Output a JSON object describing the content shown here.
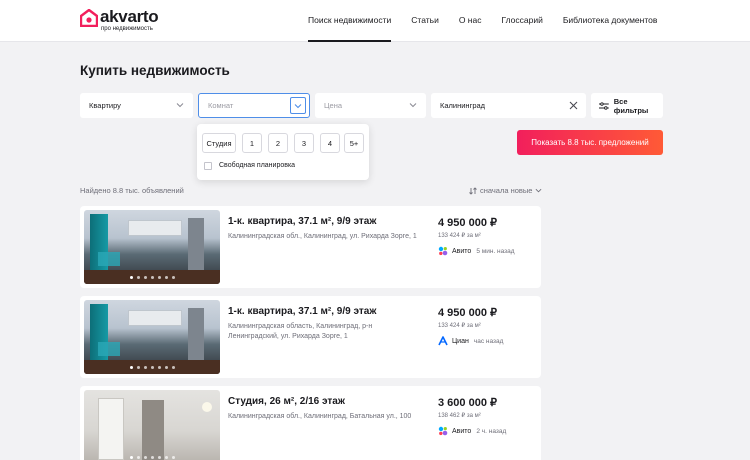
{
  "header": {
    "logo_name": "akvarto",
    "logo_tagline": "про недвижимость",
    "nav": [
      {
        "label": "Поиск недвижимости",
        "active": true
      },
      {
        "label": "Статьи",
        "active": false
      },
      {
        "label": "О нас",
        "active": false
      },
      {
        "label": "Глоссарий",
        "active": false
      },
      {
        "label": "Библиотека документов",
        "active": false
      }
    ]
  },
  "page_title": "Купить недвижимость",
  "filters": {
    "type": {
      "value": "Квартиру",
      "icon": "chevron-down-icon"
    },
    "rooms": {
      "placeholder": "Комнат",
      "icon": "chevron-down-icon"
    },
    "price": {
      "placeholder": "Цена",
      "icon": "chevron-down-icon"
    },
    "city": {
      "value": "Калининград",
      "icon": "close-icon"
    },
    "all_filters": {
      "label": "Все фильтры",
      "icon": "sliders-icon"
    }
  },
  "rooms_dropdown": {
    "options": [
      "Студия",
      "1",
      "2",
      "3",
      "4",
      "5+"
    ],
    "free_layout_label": "Свободная планировка",
    "free_layout_checked": false
  },
  "show_button": "Показать 8.8 тыс. предложений",
  "results": {
    "found_text": "Найдено 8.8 тыс. объявлений",
    "sort_label": "сначала новые"
  },
  "listings": [
    {
      "title": "1-к. квартира, 37.1 м², 9/9 этаж",
      "address": "Калининградская обл., Калининград, ул. Рихарда Зорге, 1",
      "price": "4 950 000 ₽",
      "price_per_m2": "133 424 ₽ за м²",
      "source": "Авито",
      "source_icon": "avito-icon",
      "time": "5 мин. назад"
    },
    {
      "title": "1-к. квартира, 37.1 м², 9/9 этаж",
      "address": "Калининградская область, Калининград, р-н Ленинградский, ул. Рихарда Зорге, 1",
      "price": "4 950 000 ₽",
      "price_per_m2": "133 424 ₽ за м²",
      "source": "Циан",
      "source_icon": "cian-icon",
      "time": "час назад"
    },
    {
      "title": "Студия, 26 м², 2/16 этаж",
      "address": "Калининградская обл., Калининград, Батальная ул., 100",
      "price": "3 600 000 ₽",
      "price_per_m2": "138 462 ₽ за м²",
      "source": "Авито",
      "source_icon": "avito-icon",
      "time": "2 ч. назад"
    }
  ],
  "colors": {
    "accent_gradient_start": "#f21f5c",
    "accent_gradient_end": "#ff5a36",
    "focus_border": "#4f8ee8"
  }
}
